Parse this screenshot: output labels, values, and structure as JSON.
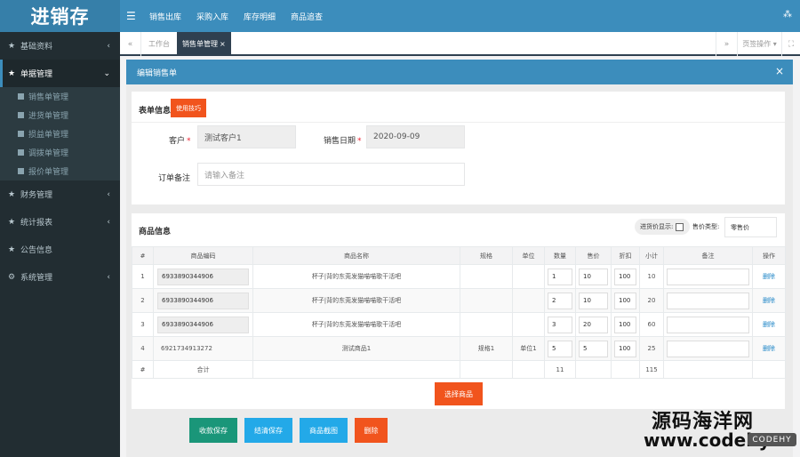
{
  "app": {
    "logo": "进销存"
  },
  "topnav": [
    "销售出库",
    "采购入库",
    "库存明细",
    "商品追查"
  ],
  "sidebar": {
    "items": [
      {
        "label": "基础资料",
        "icon": "★",
        "chev": "‹"
      },
      {
        "label": "单据管理",
        "icon": "★",
        "chev": "⌄"
      },
      {
        "label": "财务管理",
        "icon": "★",
        "chev": "‹"
      },
      {
        "label": "统计报表",
        "icon": "★",
        "chev": "‹"
      },
      {
        "label": "公告信息",
        "icon": "★",
        "chev": ""
      },
      {
        "label": "系统管理",
        "icon": "⚙",
        "chev": "‹"
      }
    ],
    "sub": [
      "销售单管理",
      "进货单管理",
      "损益单管理",
      "调拨单管理",
      "报价单管理"
    ]
  },
  "tabs": {
    "left": "«",
    "home": "工作台",
    "active": "销售单管理",
    "active_close": "×",
    "right": "»",
    "ops": "页签操作 ▾",
    "full": "⛶"
  },
  "modal": {
    "title": "编辑销售单",
    "close": "×"
  },
  "form": {
    "section_title": "表单信息",
    "tip_badge": "使用技巧",
    "customer_label": "客户",
    "customer_value": "测试客户1",
    "date_label": "销售日期",
    "date_value": "2020-09-09",
    "required_mark": "*",
    "remark_label": "订单备注",
    "remark_placeholder": "请输入备注"
  },
  "goods": {
    "section_title": "商品信息",
    "cost_toggle": "进货价显示:",
    "price_type_label": "售价类型:",
    "price_type_value": "零售价",
    "columns": [
      "#",
      "商品编码",
      "商品名称",
      "规格",
      "单位",
      "数量",
      "售价",
      "折扣",
      "小计",
      "备注",
      "操作"
    ],
    "rows": [
      {
        "no": "1",
        "code": "6933890344906",
        "name": "杯子|背的东莞发猫喵喵歌干活吧",
        "spec": "",
        "unit": "",
        "qty": "1",
        "price": "10",
        "discount": "100",
        "subtotal": "10",
        "remark": "",
        "op": "删除"
      },
      {
        "no": "2",
        "code": "6933890344906",
        "name": "杯子|背的东莞发猫喵喵歌干活吧",
        "spec": "",
        "unit": "",
        "qty": "2",
        "price": "10",
        "discount": "100",
        "subtotal": "20",
        "remark": "",
        "op": "删除"
      },
      {
        "no": "3",
        "code": "6933890344906",
        "name": "杯子|背的东莞发猫喵喵歌干活吧",
        "spec": "",
        "unit": "",
        "qty": "3",
        "price": "20",
        "discount": "100",
        "subtotal": "60",
        "remark": "",
        "op": "删除"
      },
      {
        "no": "4",
        "code": "6921734913272",
        "name": "测试商品1",
        "spec": "规格1",
        "unit": "单位1",
        "qty": "5",
        "price": "5",
        "discount": "100",
        "subtotal": "25",
        "remark": "",
        "op": "删除"
      }
    ],
    "total": {
      "no": "#",
      "label": "合计",
      "qty": "11",
      "subtotal": "115"
    },
    "select_button": "选择商品"
  },
  "actions": {
    "collect_save": "收款保存",
    "settle_save": "结清保存",
    "goods_screenshot": "商品截图",
    "delete": "删除"
  },
  "watermark": {
    "line1": "源码海洋网",
    "line2": "www.codehy",
    "badge": "CODEHY"
  }
}
